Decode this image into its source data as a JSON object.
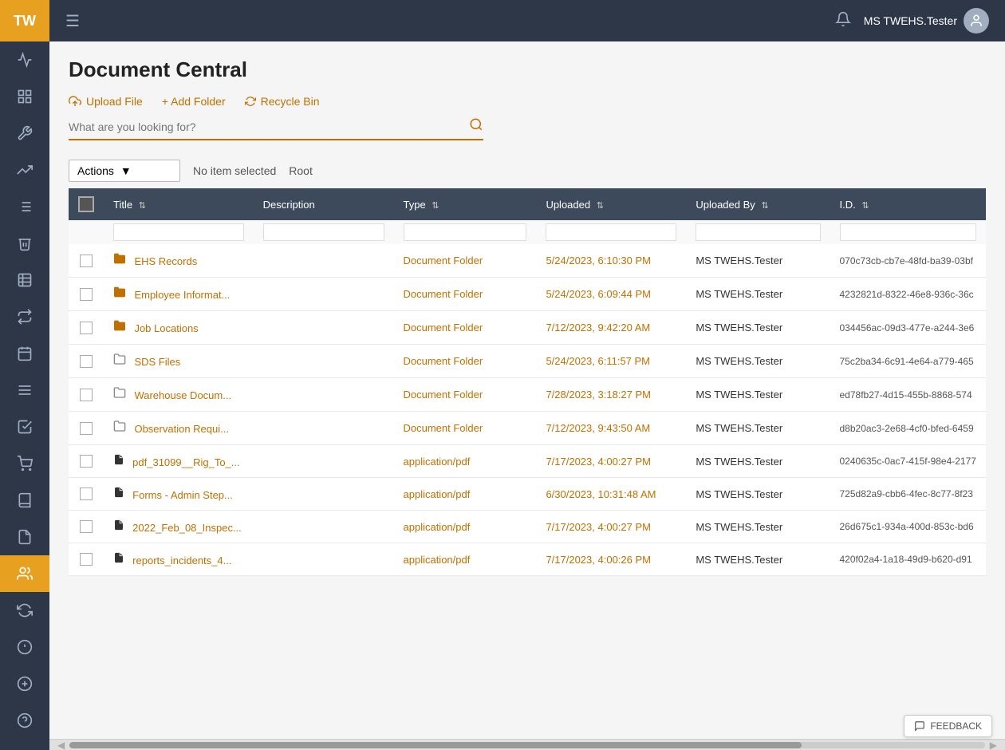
{
  "app": {
    "logo": "TW",
    "title": "Document Central",
    "breadcrumb": ""
  },
  "topbar": {
    "menu_icon": "☰",
    "bell_icon": "🔔",
    "user_name": "MS TWEHS.Tester",
    "avatar_initials": "👤"
  },
  "toolbar": {
    "upload_label": "Upload File",
    "add_folder_label": "+ Add Folder",
    "recycle_bin_label": "Recycle Bin"
  },
  "search": {
    "placeholder": "What are you looking for?"
  },
  "actions": {
    "dropdown_label": "Actions",
    "no_item_label": "No item selected",
    "root_label": "Root"
  },
  "table": {
    "columns": [
      {
        "key": "checkbox",
        "label": ""
      },
      {
        "key": "title",
        "label": "Title"
      },
      {
        "key": "description",
        "label": "Description"
      },
      {
        "key": "type",
        "label": "Type"
      },
      {
        "key": "uploaded",
        "label": "Uploaded"
      },
      {
        "key": "uploaded_by",
        "label": "Uploaded By"
      },
      {
        "key": "id",
        "label": "I.D."
      }
    ],
    "rows": [
      {
        "type_icon": "folder",
        "title": "EHS Records",
        "description": "",
        "file_type": "Document Folder",
        "uploaded": "5/24/2023, 6:10:30 PM",
        "uploaded_by": "MS TWEHS.Tester",
        "id": "070c73cb-cb7e-48fd-ba39-03bf"
      },
      {
        "type_icon": "folder",
        "title": "Employee Informat...",
        "description": "",
        "file_type": "Document Folder",
        "uploaded": "5/24/2023, 6:09:44 PM",
        "uploaded_by": "MS TWEHS.Tester",
        "id": "4232821d-8322-46e8-936c-36c"
      },
      {
        "type_icon": "folder",
        "title": "Job Locations",
        "description": "",
        "file_type": "Document Folder",
        "uploaded": "7/12/2023, 9:42:20 AM",
        "uploaded_by": "MS TWEHS.Tester",
        "id": "034456ac-09d3-477e-a244-3e6"
      },
      {
        "type_icon": "folder-outline",
        "title": "SDS Files",
        "description": "",
        "file_type": "Document Folder",
        "uploaded": "5/24/2023, 6:11:57 PM",
        "uploaded_by": "MS TWEHS.Tester",
        "id": "75c2ba34-6c91-4e64-a779-465"
      },
      {
        "type_icon": "folder-outline",
        "title": "Warehouse Docum...",
        "description": "",
        "file_type": "Document Folder",
        "uploaded": "7/28/2023, 3:18:27 PM",
        "uploaded_by": "MS TWEHS.Tester",
        "id": "ed78fb27-4d15-455b-8868-574"
      },
      {
        "type_icon": "folder-outline",
        "title": "Observation Requi...",
        "description": "",
        "file_type": "Document Folder",
        "uploaded": "7/12/2023, 9:43:50 AM",
        "uploaded_by": "MS TWEHS.Tester",
        "id": "d8b20ac3-2e68-4cf0-bfed-6459"
      },
      {
        "type_icon": "file",
        "title": "pdf_31099__Rig_To_...",
        "description": "",
        "file_type": "application/pdf",
        "uploaded": "7/17/2023, 4:00:27 PM",
        "uploaded_by": "MS TWEHS.Tester",
        "id": "0240635c-0ac7-415f-98e4-2177"
      },
      {
        "type_icon": "file",
        "title": "Forms - Admin Step...",
        "description": "",
        "file_type": "application/pdf",
        "uploaded": "6/30/2023, 10:31:48 AM",
        "uploaded_by": "MS TWEHS.Tester",
        "id": "725d82a9-cbb6-4fec-8c77-8f23"
      },
      {
        "type_icon": "file",
        "title": "2022_Feb_08_Inspec...",
        "description": "",
        "file_type": "application/pdf",
        "uploaded": "7/17/2023, 4:00:27 PM",
        "uploaded_by": "MS TWEHS.Tester",
        "id": "26d675c1-934a-400d-853c-bd6"
      },
      {
        "type_icon": "file",
        "title": "reports_incidents_4...",
        "description": "",
        "file_type": "application/pdf",
        "uploaded": "7/17/2023, 4:00:26 PM",
        "uploaded_by": "MS TWEHS.Tester",
        "id": "420f02a4-1a18-49d9-b620-d91"
      }
    ]
  },
  "feedback": {
    "label": "FEEDBACK"
  },
  "sidebar": {
    "items": [
      {
        "icon": "📈",
        "label": "analytics",
        "active": false
      },
      {
        "icon": "🔒",
        "label": "lock-grid",
        "active": false
      },
      {
        "icon": "⚙️",
        "label": "settings",
        "active": false
      },
      {
        "icon": "🔧",
        "label": "tools",
        "active": false
      },
      {
        "icon": "📋",
        "label": "tasks",
        "active": false
      },
      {
        "icon": "🗑️",
        "label": "delete",
        "active": false
      },
      {
        "icon": "📊",
        "label": "reports",
        "active": false
      },
      {
        "icon": "⇄",
        "label": "transfer",
        "active": false
      },
      {
        "icon": "📅",
        "label": "calendar",
        "active": false
      },
      {
        "icon": "📝",
        "label": "list",
        "active": false
      },
      {
        "icon": "📋",
        "label": "checklist",
        "active": false
      },
      {
        "icon": "🛒",
        "label": "shop",
        "active": false
      },
      {
        "icon": "📚",
        "label": "library-lock",
        "active": false
      },
      {
        "icon": "📄",
        "label": "document",
        "active": false
      },
      {
        "icon": "👥",
        "label": "users",
        "active": true
      },
      {
        "icon": "♻️",
        "label": "recycle",
        "active": false
      },
      {
        "icon": "💡",
        "label": "ideas",
        "active": false
      },
      {
        "icon": "➕",
        "label": "add",
        "active": false
      },
      {
        "icon": "❓",
        "label": "help",
        "active": false
      }
    ]
  }
}
